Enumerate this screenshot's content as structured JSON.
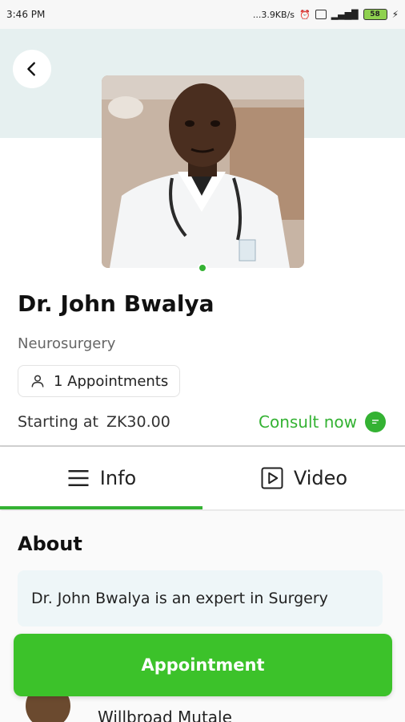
{
  "status_bar": {
    "time": "3:46 PM",
    "network_speed": "...3.9KB/s",
    "battery_level": "58",
    "icons": [
      "alarm-icon",
      "sim-icon",
      "signal-icon",
      "battery-icon",
      "charging-icon"
    ]
  },
  "header": {
    "back_icon": "chevron-left-icon"
  },
  "doctor": {
    "name": "Dr. John Bwalya",
    "specialty": "Neurosurgery",
    "appointments_label": "1 Appointments",
    "price_prefix": "Starting at",
    "price": "ZK30.00",
    "consult_label": "Consult now",
    "online": true
  },
  "tabs": [
    {
      "label": "Info",
      "icon": "menu-icon",
      "active": true
    },
    {
      "label": "Video",
      "icon": "play-icon",
      "active": false
    }
  ],
  "about": {
    "title": "About",
    "text": "Dr. John Bwalya is an expert in Surgery"
  },
  "reviews": {
    "first_reviewer": "Willbroad Mutale"
  },
  "actions": {
    "appointment_label": "Appointment"
  },
  "colors": {
    "accent": "#34b233",
    "button": "#3cc22a",
    "hero_bg": "#e6f0f0",
    "about_bg": "#eef6f8"
  }
}
